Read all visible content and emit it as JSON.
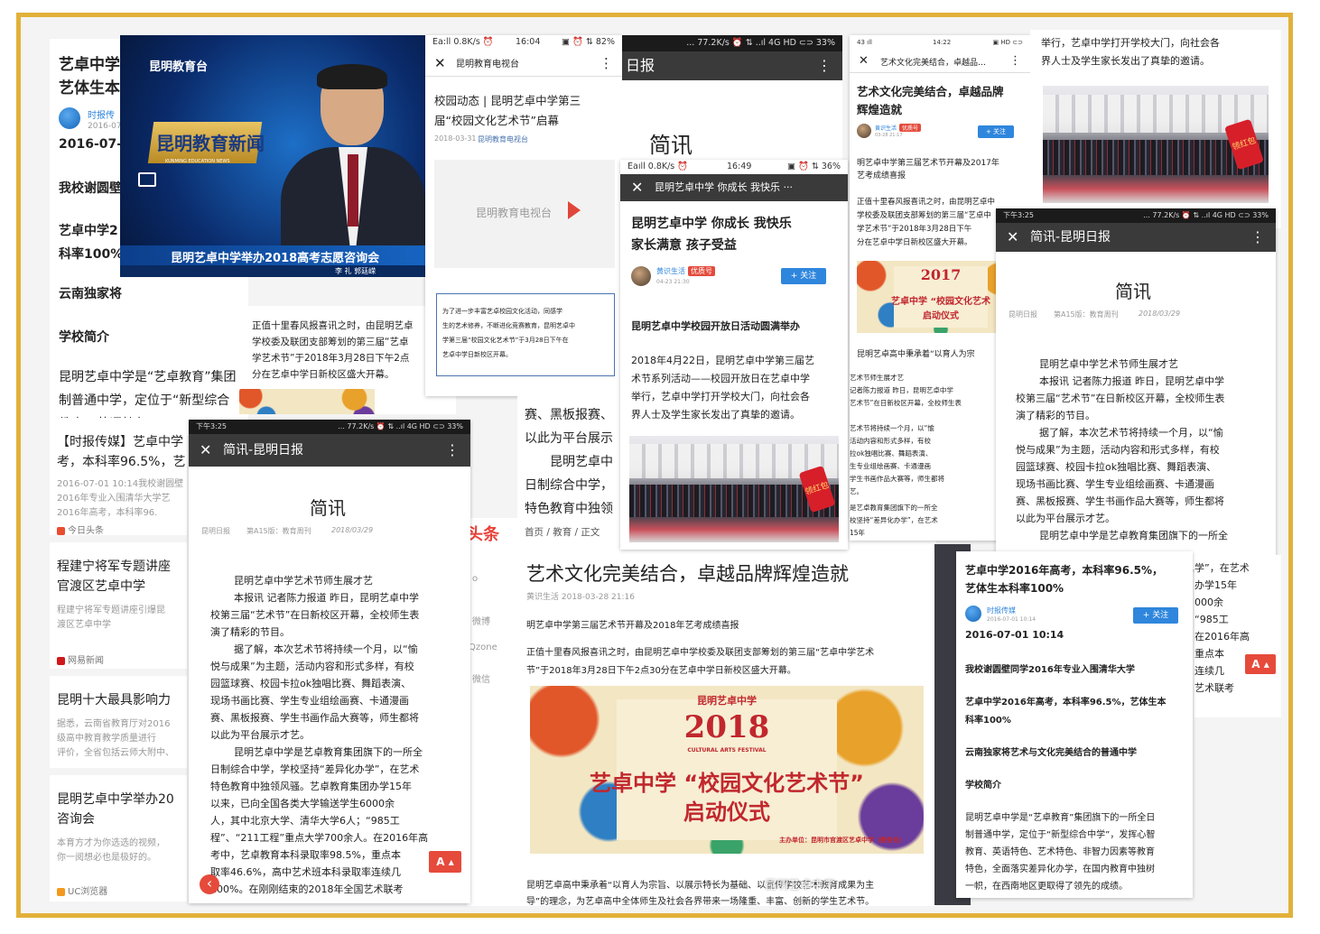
{
  "colors": {
    "frame": "#e2b13a",
    "accent_red": "#c1272d",
    "follow_blue": "#2f86dd",
    "dark_bar": "#3a3a3a"
  },
  "left_col": {
    "title": "艺卓中学2016年高考，本科率96.5%，艺体生本科率100%",
    "title_l1": "艺卓中学",
    "title_l2": "艺体生本",
    "author": "时报传",
    "date_small": "2016-07",
    "date": "2016-07-0",
    "h1": "我校谢圆壁",
    "h2a": "艺卓中学2",
    "h2b": "科率100%",
    "h3": "云南独家将",
    "h4": "学校简介",
    "p1": "昆明艺卓中学是“艺卓教育”集团",
    "p2": "制普通中学，定位于“新型综合",
    "p3": "教育、英语特色、"
  },
  "tv": {
    "channel": "昆明教育台",
    "logo": "昆明教育新闻",
    "logo_sub": "KUNMING EDUCATION NEWS",
    "caption": "昆明艺卓中学举办2018高考志愿咨询会",
    "reporters": "李  礼    郭廷嵘"
  },
  "left_text": {
    "p1": "正值十里春风报喜讯之时，由昆明艺卓",
    "p2": "学校委及联团支部筹划的第三届“艺卓",
    "p3": "学艺术节”于2018年3月28日下午2点",
    "p4": "分在艺卓中学日新校区盛大开幕。"
  },
  "wechat1": {
    "status_left": "Ea:ll  0.8K/s  ⏰",
    "status_mid": "16:04",
    "status_right": "▣ ⏰ ⇅ 82%",
    "bar": "昆明教育电视台",
    "title": "校园动态 | 昆明艺卓中学第三届“校园文化艺术节”启幕",
    "title_l1": "校园动态 | 昆明艺卓中学第三",
    "title_l2": "届“校园文化艺术节”启幕",
    "meta_date": "2018-03-31",
    "meta_src": "昆明教育电视台",
    "logo_text": "昆明教育电视台",
    "q1": "为了进一步丰富艺卓校园文化活动，同感学",
    "q2": "生的艺术修养，不断进化竞赛教育，昆明艺卓中",
    "q3": "学第三届“校园文化艺术节”于3月28日下午在",
    "q4": "艺卓中学日新校区开幕。"
  },
  "daily_top": {
    "status": "... 77.2K/s ⏰ ⇅ ..ıl 4G HD ⊂⊃ 33%",
    "bar": "日报",
    "heading": "简讯"
  },
  "bgtext_center": {
    "l1": "赛、黑板报赛、",
    "l2": "以此为平台展示",
    "l3": "昆明艺卓中",
    "l4": "日制综合中学，",
    "l5": "特色教育中独领"
  },
  "toutiao": {
    "logo": "头条",
    "crumb": "首页 / 教育 / 正文",
    "side1": "o",
    "side2": "微博",
    "side3": "Qzone",
    "side4": "微信",
    "title": "艺术文化完美结合，卓越品牌辉煌造就",
    "meta": "黄识生活   2018-03-28 21:16",
    "sub": "明艺卓中学第三届艺术节开幕及2018年艺考成绩喜报",
    "p1": "正值十里春风报喜讯之时，由昆明艺卓中学校委及联团支部筹划的第三届“艺卓中学艺术",
    "p2": "节”于2018年3月28日下午2点30分在艺卓中学日新校区盛大开幕。",
    "cap1": "昆明艺卓高中秉承着“以育人为宗旨、以展示特长为基础、以宣传学校艺术教育成果为主",
    "cap2": "导”的理念，为艺卓高中全体师生及社会各界带来一场隆重、丰富、创新的学生艺术节。",
    "watermark": "昆明艺卓中学"
  },
  "poster": {
    "school": "昆明艺卓中学",
    "year": "2018",
    "year_sub": "CULTURAL ARTS FESTIVAL",
    "line1": "艺卓中学  “校园文化艺术节”",
    "line2": "启动仪式",
    "organizer": "主办单位：昆明市官渡区艺卓中学（教务处）"
  },
  "wechat2": {
    "status_left": "Eaıll 0.8K/s ⏰",
    "status_mid": "16:49",
    "status_right": "▣ ⏰ ⇅ 36%",
    "bar": "昆明艺卓中学 你成长 我快乐 ···",
    "title_l1": "昆明艺卓中学 你成长 我快乐",
    "title_l2": "家长满意 孩子受益",
    "author": "黄识生活",
    "badge": "优质号",
    "date": "04-23 21:30",
    "follow": "+ 关注",
    "head": "昆明艺卓中学校园开放日活动圆满举办",
    "p1": "2018年4月22日，昆明艺卓中学第三届艺",
    "p2": "术节系列活动——校园开放日在艺卓中学",
    "p3": "举行，艺卓中学打开学校大门，向社会各",
    "p4": "界人士及学生家长发出了真挚的邀请。",
    "env": "领红包"
  },
  "toutiao_top": {
    "p1": "举行，艺卓中学打开学校大门，向社会各",
    "p2": "界人士及学生家长发出了真挚的邀请。",
    "env": "领红包"
  },
  "article_b": {
    "status_left": "43 ıll",
    "status_mid": "14:22",
    "status_right": "▣ HD ⊂⊃",
    "bar": "艺术文化完美结合，卓越品…",
    "title_l1": "艺术文化完美结合，卓越品牌",
    "title_l2": "辉煌造就",
    "author": "黄识生活",
    "badge": "优质号",
    "date": "03-28 21:17",
    "follow": "+ 关注",
    "sub1": "明艺卓中学第三届艺术节开幕及2017年",
    "sub2": "艺考成绩喜报",
    "p1": "正值十里春风报喜讯之时，由昆明艺卓中",
    "p2": "学校委及联团支部筹划的第三届“艺卓中",
    "p3": "学艺术节”于2018年3月28日下午",
    "p4": "分在艺卓中学日新校区盛大开幕。",
    "poster_year": "2017",
    "poster_l1": "艺卓中学 “校园文化艺术",
    "poster_l2": "启动仪式",
    "cap": "昆明艺卓高中秉承着“以育人为宗",
    "s1": "艺术节师生展才艺",
    "s2": "记者陈力报道 昨日，昆明艺卓中学",
    "s3": "艺术节”在日新校区开幕，全校师生表",
    "s4": "艺术节将持续一个月，以“愉",
    "s5": "活动内容和形式多样，有校",
    "s6": "拉ok独唱比赛、舞蹈表演、",
    "s7": "生专业组绘画赛、卡通漫画",
    "s8": "学生书画作品大赛等，师生都将",
    "s9": "艺。",
    "s10": "是艺卓教育集团旗下的一所全",
    "s11": "校坚持“差异化办学”，在艺术",
    "s12": "15年"
  },
  "daily_right": {
    "status_left": "下午3:25",
    "status_right": "... 77.2K/s ⏰ ⇅ ..ıl 4G HD ⊂⊃ 33%",
    "bar": "简讯-昆明日报",
    "heading": "简讯",
    "meta1": "昆明日报",
    "meta2": "第A15版：教育周刊",
    "meta3": "2018/03/29",
    "p1": "昆明艺卓中学艺术节师生展才艺",
    "p2": "本报讯 记者陈力报道 昨日，昆明艺卓中学",
    "p3": "校第三届“艺术节”在日新校区开幕，全校师生表",
    "p4": "演了精彩的节目。",
    "p5": "据了解，本次艺术节将持续一个月，以“愉",
    "p6": "悦与成果”为主题，活动内容和形式多样，有校",
    "p7": "园篮球赛、校园卡拉ok独唱比赛、舞蹈表演、",
    "p8": "现场书画比赛、学生专业组绘画赛、卡通漫画",
    "p9": "赛、黑板报赛、学生书画作品大赛等，师生都将",
    "p10": "以此为平台展示才艺。",
    "p11": "昆明艺卓中学是艺卓教育集团旗下的一所全"
  },
  "news_list": {
    "item1_t1": "【时报传媒】艺卓中学",
    "item1_t2": "考，本科率96.5%，艺",
    "item1_d1": "2016-07-01 10:14我校谢圆壁",
    "item1_d2": "2016年专业入围清华大学艺",
    "item1_d3": "2016年高考，本科率96.",
    "item1_src": "今日头条",
    "item2_t1": "程建宁将军专题讲座",
    "item2_t2": "官渡区艺卓中学",
    "item2_d1": "程建宁将军专题讲座引爆昆",
    "item2_d2": "渡区艺卓中学",
    "item2_src": "网易新闻",
    "item3_t1": "昆明十大最具影响力",
    "item3_d1": "据悉，云南省教育厅对2016",
    "item3_d2": "级高中教育教学质量进行",
    "item3_d3": "评价，全省包括云师大附中、",
    "item4_t1": "昆明艺卓中学举办20",
    "item4_t2": "咨询会",
    "item4_d1": "本育方才为你选选的视频，",
    "item4_d2": "你一阅想必也是极好的。",
    "item4_src": "UC浏览器",
    "back": "‹"
  },
  "daily_left": {
    "status_left": "下午3:25",
    "status_right": "... 77.2K/s ⏰ ⇅ ..ıl 4G HD ⊂⊃ 33%",
    "bar": "简讯-昆明日报",
    "heading": "简讯",
    "meta1": "昆明日报",
    "meta2": "第A15版：教育周刊",
    "meta3": "2018/03/29",
    "p1": "昆明艺卓中学艺术节师生展才艺",
    "p2": "本报讯 记者陈力报道 昨日，昆明艺卓中学",
    "p3": "校第三届“艺术节”在日新校区开幕，全校师生表",
    "p4": "演了精彩的节目。",
    "p5": "据了解，本次艺术节将持续一个月，以“愉",
    "p6": "悦与成果”为主题，活动内容和形式多样，有校",
    "p7": "园篮球赛、校园卡拉ok独唱比赛、舞蹈表演、",
    "p8": "现场书画比赛、学生专业组绘画赛、卡通漫画",
    "p9": "赛、黑板报赛、学生书画作品大赛等，师生都将",
    "p10": "以此为平台展示才艺。",
    "p11": "昆明艺卓中学是艺卓教育集团旗下的一所全",
    "p12": "日制综合中学，学校坚持“差异化办学”，在艺术",
    "p13": "特色教育中独领风骚。艺卓教育集团办学15年",
    "p14": "以来，已向全国各类大学输送学生6000余",
    "p15": "人，其中北京大学、清华大学6人；“985工",
    "p16": "程”、“211工程”重点大学700余人。在2016年高",
    "p17": "考中，艺卓教育本科录取率98.5%，重点本",
    "p18": "取率46.6%，高中艺术班本科录取率连续几",
    "p19": "100%。在刚刚结束的2018年全国艺术联考",
    "pager": "A ▴"
  },
  "article_c": {
    "title_l1": "艺卓中学2016年高考，本科率96.5%，",
    "title_l2": "艺体生本科率100%",
    "author": "时报传媒",
    "date_small": "2016-07-01 10:14",
    "follow": "+ 关注",
    "date": "2016-07-01 10:14",
    "h1": "我校谢圆壁同学2016年专业入围清华大学",
    "h2a": "艺卓中学2016年高考，本科率96.5%，艺体生本",
    "h2b": "科率100%",
    "h3": "云南独家将艺术与文化完美结合的普通中学",
    "h4": "学校简介",
    "p1": "昆明艺卓中学是“艺卓教育”集团旗下的一所全日",
    "p2": "制普通中学，定位于“新型综合中学”，发挥心智",
    "p3": "教育、英语特色、艺术特色、非智力因素等教育",
    "p4": "特色，全面落实差异化办学，在国内教育中独树",
    "p5": "一帜，在西南地区更取得了领先的成绩。"
  },
  "right_strip": {
    "l1": "学”，在艺术",
    "l2": "办学15年",
    "l3": "000余",
    "l4": "“985工",
    "l5": "在2016年高",
    "l6": "重点本",
    "l7": "连续几",
    "l8": "艺术联考",
    "pager": "A ▴"
  }
}
